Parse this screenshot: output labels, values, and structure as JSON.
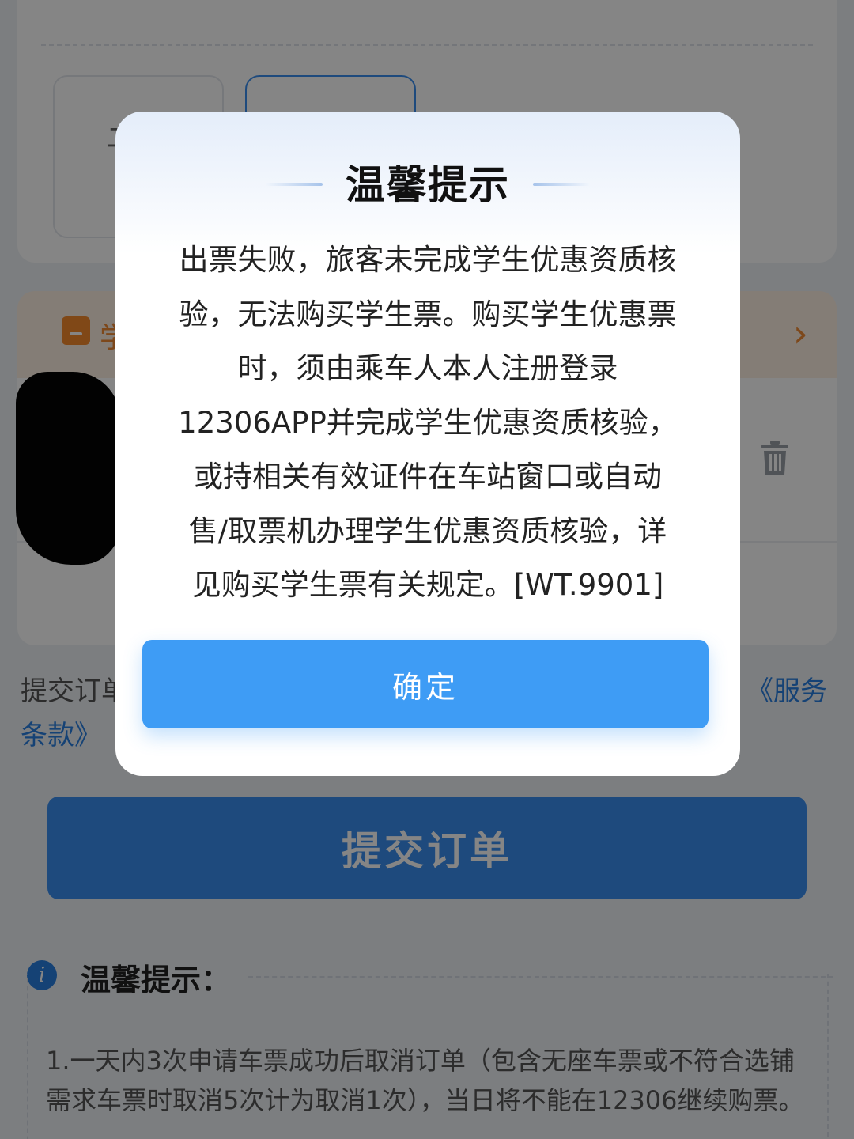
{
  "background": {
    "seat_option_glyph": "二",
    "student_banner_label": "学",
    "terms_prefix": "提交订单",
    "terms_link_1": "《服务",
    "terms_link_2": "条款》",
    "submit_label": "提交订单",
    "tips_title": "温馨提示：",
    "tips_text": "1.一天内3次申请车票成功后取消订单（包含无座车票或不符合选铺需求车票时取消5次计为取消1次），当日将不能在12306继续购票。"
  },
  "dialog": {
    "title": "温馨提示",
    "lines": [
      "出票失败，旅客未完成学生优惠资质核",
      "验，无法购买学生票。购买学生优惠票",
      "时，须由乘车人本人注册登录",
      "12306APP并完成学生优惠资质核验，",
      "或持相关有效证件在车站窗口或自动",
      "售/取票机办理学生优惠资质核验，详",
      "见购买学生票有关规定。[WT.9901]"
    ],
    "confirm_label": "确定"
  },
  "colors": {
    "accent": "#3e9cf5",
    "link": "#2a7fe0",
    "banner": "#fdefe3",
    "banner_text": "#f08a34"
  }
}
